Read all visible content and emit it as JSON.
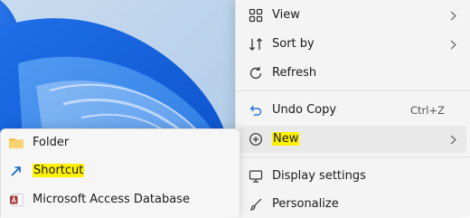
{
  "menu": {
    "items": [
      {
        "label": "View",
        "icon": "grid-icon",
        "has_submenu": true
      },
      {
        "label": "Sort by",
        "icon": "sort-icon",
        "has_submenu": true
      },
      {
        "label": "Refresh",
        "icon": "refresh-icon",
        "has_submenu": false
      },
      {
        "label": "Undo Copy",
        "icon": "undo-icon",
        "shortcut": "Ctrl+Z",
        "has_submenu": false
      },
      {
        "label": "New",
        "icon": "plus-circle-icon",
        "has_submenu": true,
        "highlighted": true
      },
      {
        "label": "Display settings",
        "icon": "display-icon",
        "has_submenu": false
      },
      {
        "label": "Personalize",
        "icon": "brush-icon",
        "has_submenu": false
      }
    ]
  },
  "submenu": {
    "items": [
      {
        "label": "Folder",
        "icon": "folder-icon"
      },
      {
        "label": "Shortcut",
        "icon": "shortcut-arrow-icon",
        "highlighted": true
      },
      {
        "label": "Microsoft Access Database",
        "icon": "access-database-icon"
      }
    ]
  },
  "colors": {
    "highlight": "#fff200",
    "access_red": "#a4373a",
    "folder_yellow": "#f2c14e",
    "shortcut_blue": "#0b62c4"
  }
}
